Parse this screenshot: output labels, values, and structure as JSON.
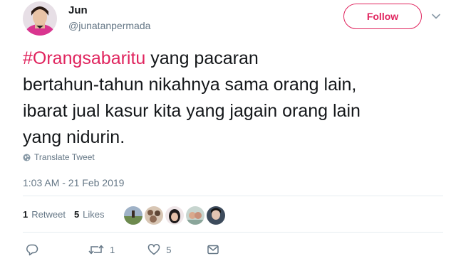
{
  "user": {
    "name": "Jun",
    "handle": "@junatanpermada"
  },
  "follow_button": {
    "label": "Follow"
  },
  "tweet": {
    "hashtag": "#Orangsabaritu",
    "line1_rest": " yang pacaran",
    "line2": "bertahun-tahun nikahnya sama orang lain,",
    "line3": "ibarat jual kasur kita yang jagain orang lain",
    "line4": "yang nidurin."
  },
  "translate_label": "Translate Tweet",
  "timestamp": "1:03 AM - 21 Feb 2019",
  "stats": {
    "retweets_count": "1",
    "retweets_label": "Retweet",
    "likes_count": "5",
    "likes_label": "Likes"
  },
  "actions": {
    "reply_count": "",
    "retweet_count": "1",
    "like_count": "5"
  },
  "colors": {
    "accent": "#e0245e",
    "text": "#14171a",
    "muted": "#657786",
    "divider": "#e6ecf0"
  },
  "icons": {
    "menu": "chevron-down-icon",
    "translate": "globe-icon",
    "reply": "reply-icon",
    "retweet": "retweet-icon",
    "like": "heart-icon",
    "message": "direct-message-icon"
  }
}
